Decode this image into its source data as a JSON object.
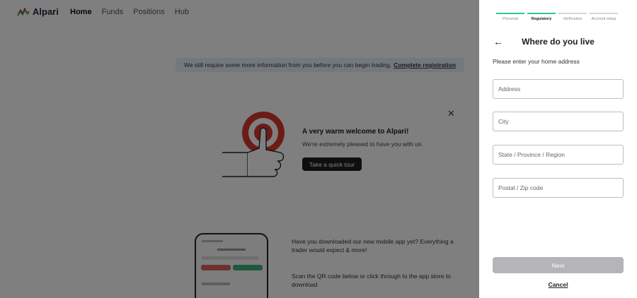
{
  "nav": {
    "logo_text": "Alpari",
    "links": [
      "Home",
      "Funds",
      "Positions",
      "Hub"
    ]
  },
  "banner": {
    "text": "We still require some more information from you before you can begin trading.",
    "link": "Complete registration"
  },
  "welcome": {
    "title": "A very warm welcome to Alpari!",
    "subtitle": "We're extremely pleased to have you with us.",
    "tour_button": "Take a quick tour"
  },
  "app_promo": {
    "text": "Have you downloaded our new mobile app yet? Everything a trader would expect & more!",
    "scan_text": "Scan the QR code below or click through to the app store to download"
  },
  "panel": {
    "steps": [
      {
        "label": "Personal",
        "state": "done"
      },
      {
        "label": "Regulatory",
        "state": "current"
      },
      {
        "label": "Verification",
        "state": "todo"
      },
      {
        "label": "Account setup",
        "state": "todo"
      }
    ],
    "title": "Where do you live",
    "subtitle": "Please enter your home address",
    "fields": {
      "address": {
        "placeholder": "Address",
        "value": ""
      },
      "city": {
        "placeholder": "City",
        "value": ""
      },
      "state": {
        "placeholder": "State / Province / Region",
        "value": ""
      },
      "postal": {
        "placeholder": "Postal / Zip code",
        "value": ""
      }
    },
    "next_label": "Next",
    "cancel_label": "Cancel"
  },
  "icons": {
    "back": "arrow-left-icon",
    "close": "close-icon",
    "logo": "alpari-logo-icon"
  },
  "colors": {
    "accent_green": "#2ec98a",
    "next_disabled": "#b5b5b9",
    "overlay": "rgba(0,0,0,0.5)"
  }
}
